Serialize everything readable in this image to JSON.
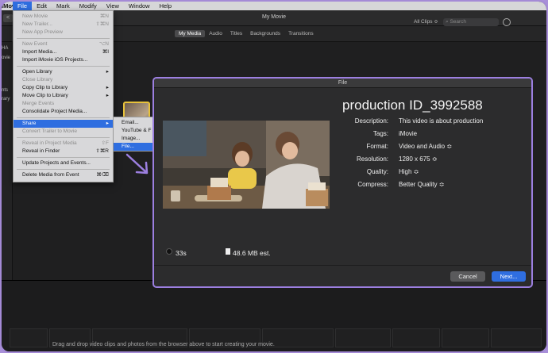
{
  "menubar": {
    "app_name": "iMovie",
    "items": [
      {
        "label": "File",
        "active": true
      },
      {
        "label": "Edit"
      },
      {
        "label": "Mark"
      },
      {
        "label": "Modify"
      },
      {
        "label": "View"
      },
      {
        "label": "Window"
      },
      {
        "label": "Help"
      }
    ]
  },
  "window": {
    "title": "My Movie",
    "back_label": "<"
  },
  "toolbar": {
    "tabs": [
      "My Media",
      "Audio",
      "Titles",
      "Backgrounds",
      "Transitions"
    ],
    "selected_tab": "My Media",
    "clips_filter": "All Clips",
    "search_placeholder": "Search"
  },
  "sidebar": {
    "labels": [
      "HA",
      "ovie",
      "nts",
      "rary"
    ]
  },
  "file_menu": {
    "items": [
      {
        "label": "New Movie",
        "shortcut": "⌘N",
        "disabled": true
      },
      {
        "label": "New Trailer...",
        "shortcut": "⇧⌘N",
        "disabled": true
      },
      {
        "label": "New App Preview",
        "shortcut": "",
        "disabled": true
      },
      {
        "label": "New Event",
        "shortcut": "⌥N",
        "disabled": true
      },
      {
        "label": "Import Media...",
        "shortcut": "⌘I",
        "disabled": false
      },
      {
        "label": "Import iMovie iOS Projects...",
        "shortcut": "",
        "disabled": false
      },
      {
        "label": "Open Library",
        "shortcut": "▸",
        "disabled": false
      },
      {
        "label": "Close Library",
        "shortcut": "",
        "disabled": true
      },
      {
        "label": "Copy Clip to Library",
        "shortcut": "▸",
        "disabled": false
      },
      {
        "label": "Move Clip to Library",
        "shortcut": "▸",
        "disabled": false
      },
      {
        "label": "Merge Events",
        "shortcut": "",
        "disabled": true
      },
      {
        "label": "Consolidate Project Media...",
        "shortcut": "",
        "disabled": false
      },
      {
        "label": "Share",
        "shortcut": "▸",
        "disabled": false,
        "highlighted": true
      },
      {
        "label": "Convert Trailer to Movie",
        "shortcut": "",
        "disabled": true
      },
      {
        "label": "Reveal in Project Media",
        "shortcut": "⇧F",
        "disabled": true
      },
      {
        "label": "Reveal in Finder",
        "shortcut": "⇧⌘R",
        "disabled": false
      },
      {
        "label": "Update Projects and Events...",
        "shortcut": "",
        "disabled": false
      },
      {
        "label": "Delete Media from Event",
        "shortcut": "⌘⌫",
        "disabled": false
      }
    ]
  },
  "share_submenu": {
    "items": [
      {
        "label": "Email..."
      },
      {
        "label": "YouTube & F"
      },
      {
        "label": "Image..."
      },
      {
        "label": "File...",
        "highlighted": true
      }
    ]
  },
  "dialog": {
    "header": "File",
    "title": "production ID_3992588",
    "fields": [
      {
        "label": "Description:",
        "value": "This video is about production"
      },
      {
        "label": "Tags:",
        "value": "iMovie"
      },
      {
        "label": "Format:",
        "value": "Video and Audio ≎"
      },
      {
        "label": "Resolution:",
        "value": "1280 x 675 ≎"
      },
      {
        "label": "Quality:",
        "value": "High ≎"
      },
      {
        "label": "Compress:",
        "value": "Better Quality ≎"
      }
    ],
    "duration": "33s",
    "file_size": "48.6 MB est.",
    "cancel_label": "Cancel",
    "next_label": "Next..."
  },
  "timeline": {
    "hint": "Drag and drop video clips and photos from the browser above to start creating your movie."
  },
  "colors": {
    "accent": "#2f6ee0",
    "dialog_border": "#9c7fe0",
    "frame": "#a88fd8"
  }
}
